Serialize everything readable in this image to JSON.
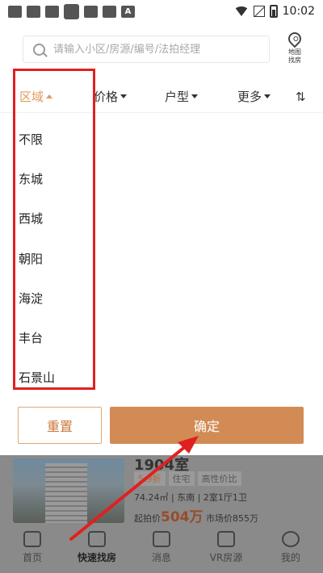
{
  "status_bar": {
    "time": "10:02",
    "letter_icon": "A"
  },
  "search": {
    "placeholder": "请输入小区/房源/编号/法拍经理"
  },
  "map_button": {
    "line1": "地图",
    "line2": "找房"
  },
  "filters": {
    "tabs": [
      "区域",
      "价格",
      "户型",
      "更多"
    ],
    "sort_icon": "⇅"
  },
  "regions": [
    "不限",
    "东城",
    "西城",
    "朝阳",
    "海淀",
    "丰台",
    "石景山"
  ],
  "actions": {
    "reset_label": "重置",
    "confirm_label": "确定"
  },
  "listing": {
    "title": "1904室",
    "tags": [
      "5.9折",
      "住宅",
      "高性价比"
    ],
    "area": "74.24㎡",
    "orientation": "东南",
    "layout": "2室1厅1卫",
    "start_label": "起拍价",
    "start_price": "504万",
    "market_label": "市场价855万"
  },
  "nav": {
    "items": [
      "首页",
      "快速找房",
      "消息",
      "VR房源",
      "我的"
    ]
  },
  "colors": {
    "accent": "#d28b55",
    "annotation": "#e02020"
  }
}
